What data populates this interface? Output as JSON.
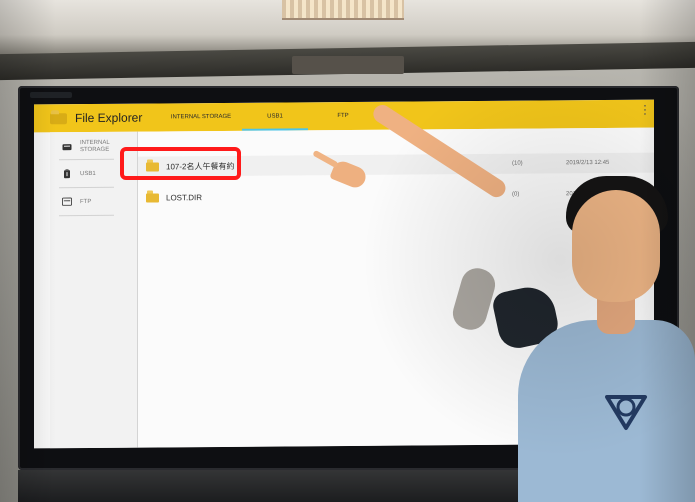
{
  "app": {
    "title": "File Explorer"
  },
  "tabs": [
    {
      "label": "INTERNAL STORAGE"
    },
    {
      "label": "USB1",
      "selected": true
    },
    {
      "label": "FTP"
    }
  ],
  "sidebar": {
    "items": [
      {
        "label": "INTERNAL\nSTORAGE",
        "icon": "storage-icon"
      },
      {
        "label": "USB1",
        "icon": "usb-icon",
        "selected": true
      },
      {
        "label": "FTP",
        "icon": "ftp-icon"
      }
    ]
  },
  "files": [
    {
      "name": "107-2名人午餐有約",
      "count": "(10)",
      "date": "2019/2/13 12:45",
      "icon": "folder-icon",
      "highlighted": true
    },
    {
      "name": "LOST.DIR",
      "count": "(0)",
      "date": "2019/2",
      "icon": "folder-icon"
    }
  ],
  "colors": {
    "toolbar": "#f1c51a",
    "selected_tab": "#4cc4ea",
    "highlight": "#ff1a1a",
    "folder": "#e8b933"
  }
}
